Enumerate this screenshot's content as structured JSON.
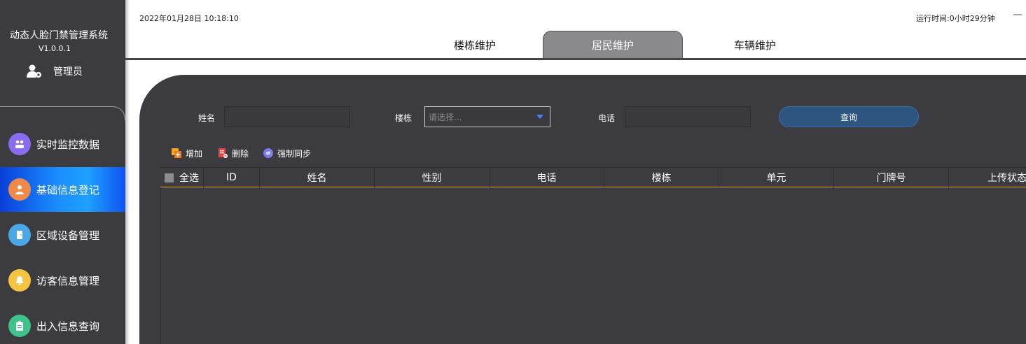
{
  "app": {
    "title": "动态人脸门禁管理系统",
    "version": "V1.0.0.1",
    "user": "管理员"
  },
  "header": {
    "datetime": "2022年01月28日 10:18:10",
    "runtime": "运行时间:0小时29分钟",
    "minimize": "—"
  },
  "menu": [
    {
      "label": "实时监控数据",
      "icon": "people-group-icon",
      "color": "#8b6cf0"
    },
    {
      "label": "基础信息登记",
      "icon": "person-icon",
      "color": "#f08a4b"
    },
    {
      "label": "区域设备管理",
      "icon": "door-icon",
      "color": "#4aa8e8"
    },
    {
      "label": "访客信息管理",
      "icon": "bell-icon",
      "color": "#f5c542"
    },
    {
      "label": "出入信息查询",
      "icon": "clipboard-icon",
      "color": "#3fc38a"
    }
  ],
  "tabs": [
    {
      "label": "楼栋维护"
    },
    {
      "label": "居民维护"
    },
    {
      "label": "车辆维护"
    }
  ],
  "filters": {
    "name_label": "姓名",
    "name_value": "",
    "building_label": "楼栋",
    "building_placeholder": "请选择...",
    "phone_label": "电话",
    "phone_value": "",
    "query_label": "查询"
  },
  "toolbar": {
    "add": "增加",
    "delete": "删除",
    "sync": "强制同步"
  },
  "table": {
    "columns": [
      "全选",
      "ID",
      "姓名",
      "性别",
      "电话",
      "楼栋",
      "单元",
      "门牌号",
      "上传状态"
    ],
    "rows": []
  },
  "colors": {
    "sidebar_bg": "#3c3c40",
    "active_menu": "#1a8cff",
    "header_accent": "#f0a330",
    "query_button": "#2e5580"
  }
}
